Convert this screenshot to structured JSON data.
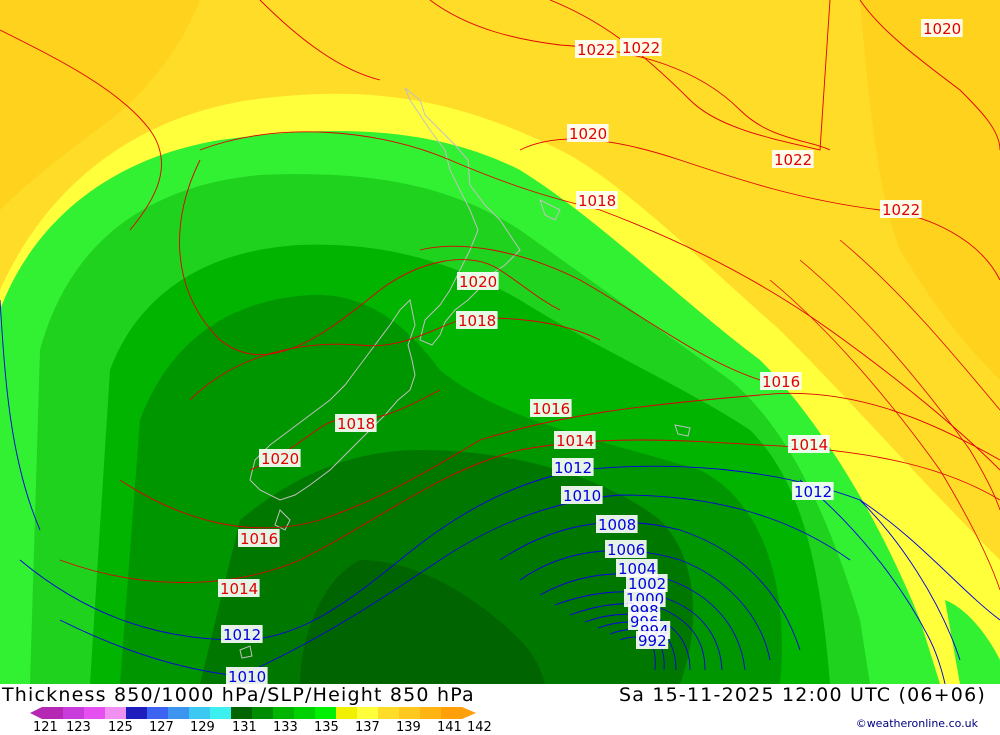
{
  "map": {
    "pressure_labels": [
      {
        "text": "1022",
        "color": "red"
      },
      {
        "text": "1022",
        "color": "red"
      },
      {
        "text": "1020",
        "color": "red"
      },
      {
        "text": "1020",
        "color": "red"
      },
      {
        "text": "1022",
        "color": "red"
      },
      {
        "text": "1022",
        "color": "red"
      },
      {
        "text": "1018",
        "color": "red"
      },
      {
        "text": "1020",
        "color": "red"
      },
      {
        "text": "1018",
        "color": "red"
      },
      {
        "text": "1016",
        "color": "red"
      },
      {
        "text": "1018",
        "color": "red"
      },
      {
        "text": "1016",
        "color": "red"
      },
      {
        "text": "1014",
        "color": "red"
      },
      {
        "text": "1014",
        "color": "red"
      },
      {
        "text": "1020",
        "color": "red"
      },
      {
        "text": "1016",
        "color": "red"
      },
      {
        "text": "1014",
        "color": "red"
      },
      {
        "text": "1012",
        "color": "blue"
      },
      {
        "text": "1012",
        "color": "blue"
      },
      {
        "text": "1010",
        "color": "blue"
      },
      {
        "text": "1008",
        "color": "blue"
      },
      {
        "text": "1006",
        "color": "blue"
      },
      {
        "text": "1004",
        "color": "blue"
      },
      {
        "text": "1002",
        "color": "blue"
      },
      {
        "text": "1000",
        "color": "blue"
      },
      {
        "text": "998",
        "color": "blue"
      },
      {
        "text": "996",
        "color": "blue"
      },
      {
        "text": "994",
        "color": "blue"
      },
      {
        "text": "992",
        "color": "blue"
      },
      {
        "text": "1012",
        "color": "blue"
      },
      {
        "text": "1010",
        "color": "blue"
      }
    ]
  },
  "footer": {
    "title": "Thickness 850/1000 hPa/SLP/Height 850 hPa",
    "datetime": "Sa 15-11-2025 12:00 UTC (06+06)",
    "credit": "©weatheronline.co.uk"
  },
  "legend": {
    "labels": [
      "121",
      "123",
      "125",
      "127",
      "129",
      "131",
      "133",
      "135",
      "137",
      "139",
      "141",
      "142"
    ],
    "colors": [
      "#b428b4",
      "#c83cdc",
      "#e650f0",
      "#f090f0",
      "#1e1ebe",
      "#3c64f0",
      "#3c96f0",
      "#3cc8f0",
      "#3cf0f0",
      "#006400",
      "#008c00",
      "#00b400",
      "#00d200",
      "#00f000",
      "#f0f000",
      "#ffff3c",
      "#ffdc28",
      "#ffc81e",
      "#ffb414",
      "#ffa00a"
    ],
    "colors_pale": {
      "c1": "#b428b4",
      "c2": "#ffa00a"
    }
  },
  "colors": {
    "band_yellow_orange": "#ffd21e",
    "band_yellow": "#ffe628",
    "band_light_yellow": "#ffff3c",
    "band_green_1": "#32f032",
    "band_green_2": "#1ed21e",
    "band_green_3": "#00b400",
    "band_green_4": "#009600",
    "band_green_5": "#007800",
    "isobar_red": "#e00000",
    "isobar_blue": "#0000e0",
    "coast": "#c0c0c0"
  }
}
